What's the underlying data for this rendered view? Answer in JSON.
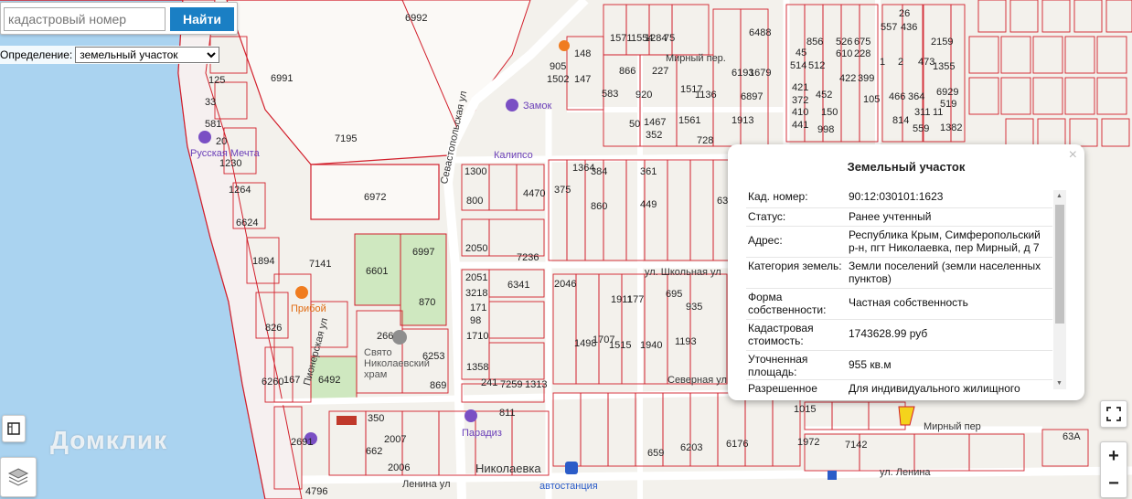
{
  "search": {
    "placeholder": "кадастровый номер",
    "button_label": "Найти"
  },
  "definition": {
    "label": "Определение:",
    "selected": "земельный участок"
  },
  "popup": {
    "title": "Земельный участок",
    "close_glyph": "×",
    "rows": [
      {
        "key": "Кад. номер:",
        "value": "90:12:030101:1623"
      },
      {
        "key": "Статус:",
        "value": "Ранее учтенный"
      },
      {
        "key": "Адрес:",
        "value": "Республика Крым, Симферопольский р-н, пгт Николаевка, пер Мирный, д 7"
      },
      {
        "key": "Категория земель:",
        "value": "Земли поселений (земли населенных пунктов)"
      },
      {
        "key": "Форма собственности:",
        "value": "Частная собственность"
      },
      {
        "key": "Кадастровая стоимость:",
        "value": "1743628.99 руб"
      },
      {
        "key": "Уточненная площадь:",
        "value": "955 кв.м"
      },
      {
        "key": "Разрешенное",
        "value": "Для индивидуального жилищного"
      }
    ]
  },
  "controls": {
    "zoom_in": "+",
    "zoom_out": "−"
  },
  "watermark": "Домклик",
  "map_labels": {
    "parcels": [
      "6992",
      "6991",
      "7195",
      "6972",
      "6997",
      "7141",
      "6601",
      "870",
      "266",
      "6253",
      "869",
      "6492",
      "350",
      "1300",
      "800",
      "4470",
      "2050",
      "7236",
      "2051",
      "3218",
      "171",
      "98",
      "1710",
      "1358",
      "241",
      "7259",
      "1313",
      "6341",
      "2046",
      "125",
      "33",
      "581",
      "20",
      "1230",
      "1264",
      "6624",
      "1894",
      "826",
      "167",
      "6260",
      "2691",
      "4796",
      "662",
      "2007",
      "2006",
      "905",
      "1502",
      "148",
      "147",
      "866",
      "920",
      "227",
      "583",
      "1571",
      "1554",
      "1284",
      "75",
      "1517",
      "1136",
      "6488",
      "6193",
      "1679",
      "6897",
      "1913",
      "1561",
      "728",
      "1467",
      "352",
      "50",
      "1364",
      "375",
      "384",
      "361",
      "449",
      "860",
      "1911",
      "177",
      "1498",
      "1707",
      "1515",
      "1940",
      "1193",
      "695",
      "935",
      "6318",
      "811",
      "659",
      "6203",
      "6176",
      "1972",
      "7142",
      "1015",
      "63А",
      "26",
      "557",
      "436",
      "2159",
      "1355",
      "6929",
      "519",
      "1382",
      "526",
      "675",
      "610",
      "228",
      "422",
      "399",
      "105",
      "466",
      "364",
      "814",
      "559",
      "856",
      "514",
      "512",
      "421",
      "372",
      "410",
      "441",
      "998",
      "452",
      "150",
      "45",
      "473",
      "311",
      "11",
      "1",
      "2",
      "3"
    ],
    "streets": [
      "ул. Ленина",
      "Мирный пер",
      "Севастопольская ул",
      "ул. Школьная ул",
      "Пионерская ул",
      "Ленина ул",
      "Мирный пер.",
      "Северная ул"
    ],
    "pois": [
      "Прибой",
      "Свято Николаевский храм",
      "Парадиз",
      "Николаевка",
      "Калипсо",
      "Замок",
      "Русская Мечта",
      "автостанция"
    ]
  }
}
